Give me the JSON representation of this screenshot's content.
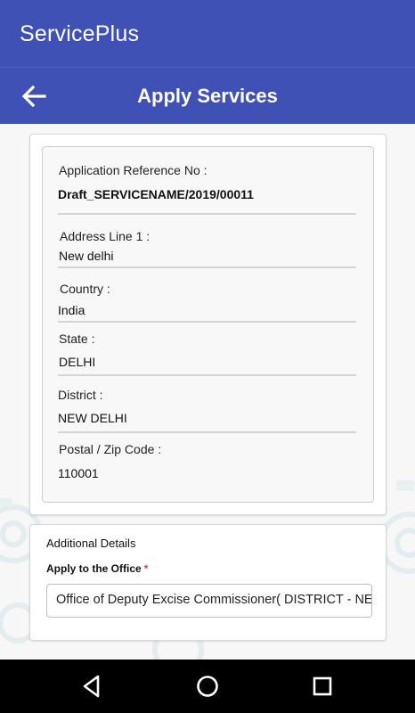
{
  "app": {
    "title": "ServicePlus"
  },
  "header": {
    "title": "Apply Services",
    "back_icon": "arrow-left-icon"
  },
  "details": {
    "reference_label": "Application  Reference No :",
    "reference_value": "Draft_SERVICENAME/2019/00011",
    "address_label": "Address Line 1 :",
    "address_value": "New delhi",
    "country_label": "Country :",
    "country_value": "India",
    "state_label": "State :",
    "state_value": "DELHI",
    "district_label": "District :",
    "district_value": "NEW DELHI",
    "postal_label": "Postal / Zip Code :",
    "postal_value": "110001"
  },
  "additional": {
    "title": "Additional Details",
    "office_label": "Apply to the Office",
    "required_mark": "*",
    "office_value": "Office of Deputy Excise Commissioner( DISTRICT - NEW DELHI)"
  },
  "nav": {
    "back_icon": "triangle-back-icon",
    "home_icon": "circle-home-icon",
    "recents_icon": "square-recents-icon"
  },
  "colors": {
    "primary": "#3f51b5",
    "required": "#e53935",
    "nav_bar": "#000000"
  }
}
